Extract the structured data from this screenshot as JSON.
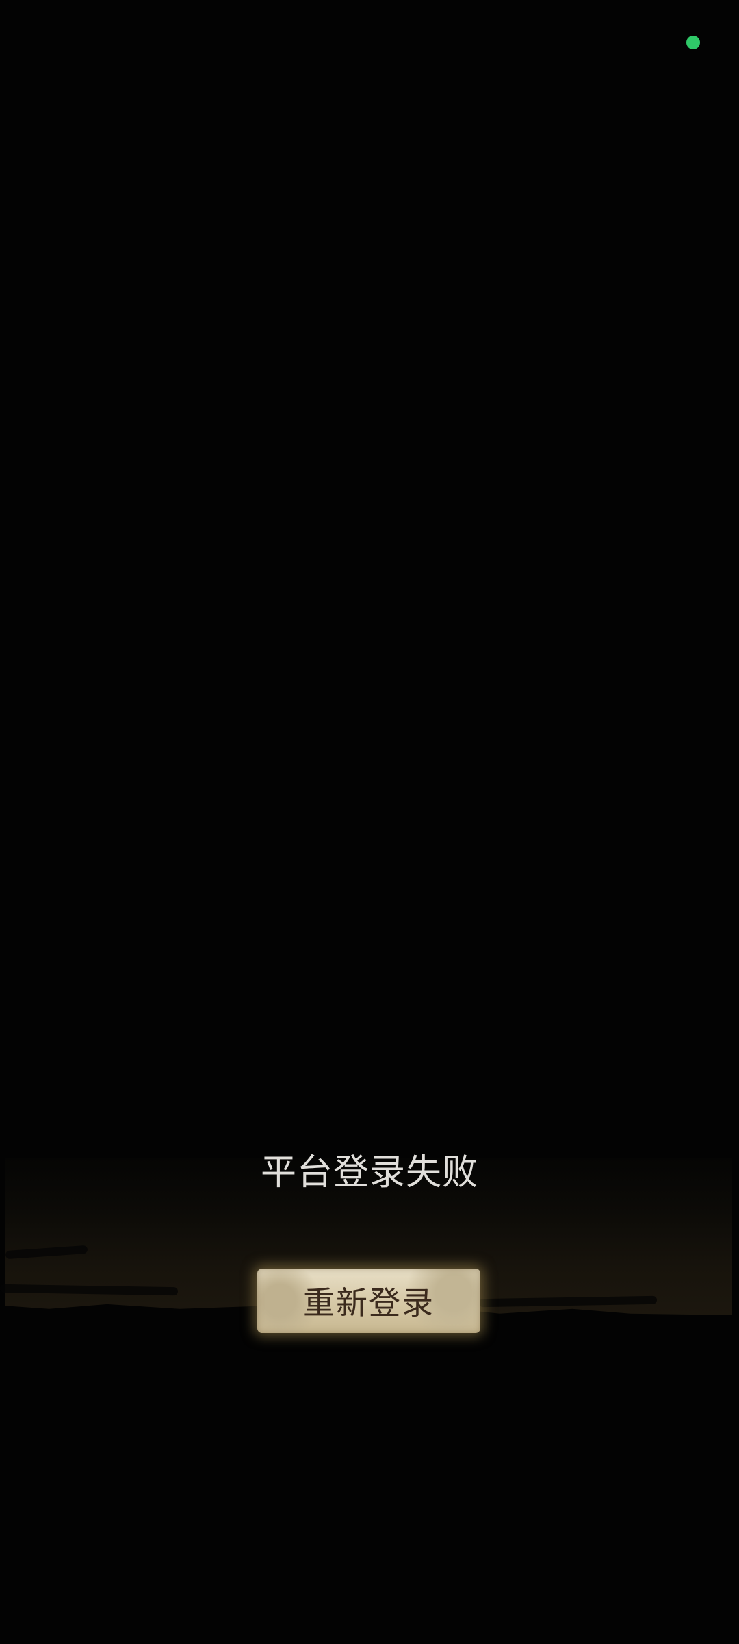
{
  "status": {
    "indicator_color": "#2fc968"
  },
  "dialog": {
    "message": "平台登录失败",
    "button_label": "重新登录"
  },
  "theme": {
    "background": "#030303",
    "panel_gradient_end": "#1c170e",
    "button_text": "#3b2a1d"
  }
}
